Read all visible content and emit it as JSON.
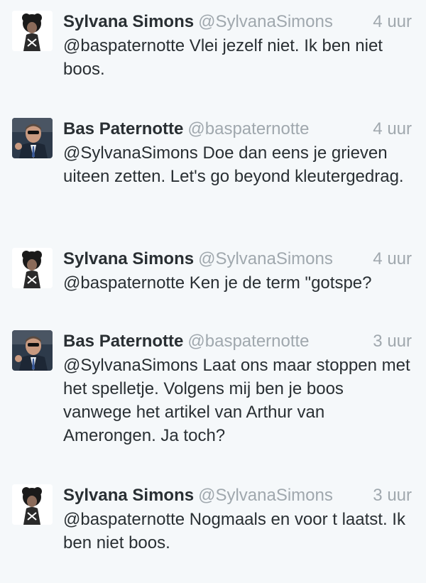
{
  "tweets": [
    {
      "author": "sylvana",
      "name": "Sylvana Simons",
      "handle": "@SylvanaSimons",
      "time": "4 uur",
      "text": "@baspaternotte Vlei jezelf niet. Ik ben niet boos."
    },
    {
      "author": "bas",
      "name": "Bas Paternotte",
      "handle": "@baspaternotte",
      "time": "4 uur",
      "text": "@SylvanaSimons Doe dan eens je grieven uiteen zetten. Let's go beyond kleutergedrag."
    },
    {
      "author": "sylvana",
      "name": "Sylvana Simons",
      "handle": "@SylvanaSimons",
      "time": "4 uur",
      "text": "@baspaternotte Ken je de term \"gotspe?"
    },
    {
      "author": "bas",
      "name": "Bas Paternotte",
      "handle": "@baspaternotte",
      "time": "3 uur",
      "text": "@SylvanaSimons Laat ons maar stoppen met het spelletje. Volgens mij ben je boos vanwege het artikel van Arthur van Amerongen. Ja toch?"
    },
    {
      "author": "sylvana",
      "name": "Sylvana Simons",
      "handle": "@SylvanaSimons",
      "time": "3 uur",
      "text": "@baspaternotte Nogmaals en voor t laatst. Ik ben niet boos."
    }
  ],
  "colors": {
    "background": "#f5f8fa",
    "name": "#292f33",
    "meta": "#a0a8ae"
  },
  "icons": {
    "sylvana": "avatar-sylvana-portrait",
    "bas": "avatar-bas-portrait"
  }
}
